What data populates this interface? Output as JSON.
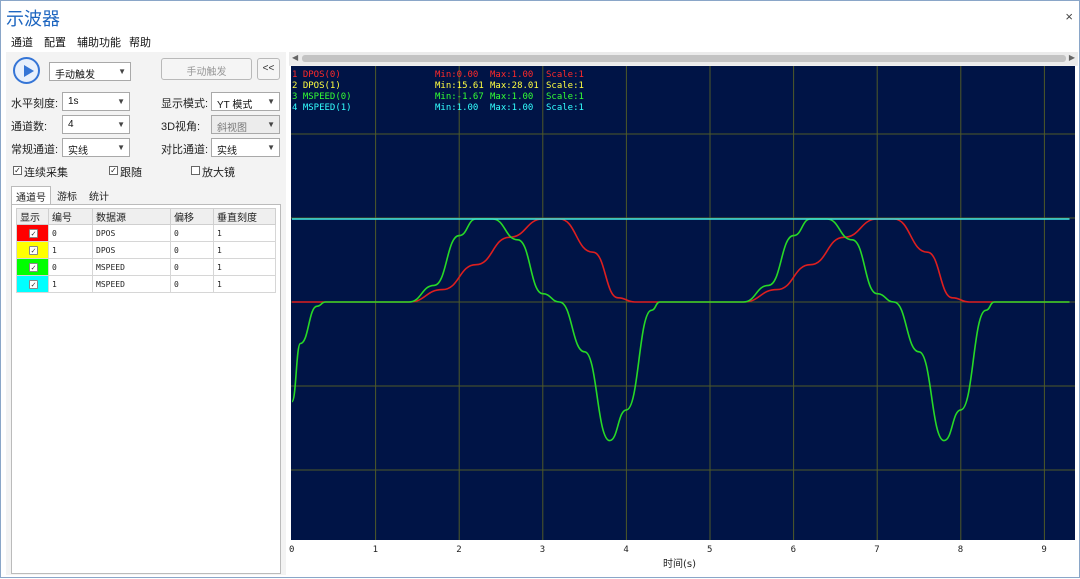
{
  "window": {
    "title": "示波器",
    "close_glyph": "×"
  },
  "menu": [
    "通道",
    "配置",
    "辅助功能",
    "帮助"
  ],
  "controls": {
    "trigger_mode": "手动触发",
    "manual_trigger_button": "手动触发",
    "collapse_button": "<<",
    "horizontal_scale_label": "水平刻度:",
    "horizontal_scale_value": "1s",
    "display_mode_label": "显示模式:",
    "display_mode_value": "YT 模式",
    "channel_count_label": "通道数:",
    "channel_count_value": "4",
    "view3d_label": "3D视角:",
    "view3d_value": "斜视图",
    "normal_channel_label": "常规通道:",
    "normal_channel_value": "实线",
    "compare_channel_label": "对比通道:",
    "compare_channel_value": "实线",
    "continuous_label": "连续采集",
    "continuous_checked": true,
    "follow_label": "跟随",
    "follow_checked": true,
    "magnifier_label": "放大镜",
    "magnifier_checked": false
  },
  "tabs": [
    "通道号",
    "游标",
    "统计"
  ],
  "channel_table": {
    "headers": [
      "显示",
      "编号",
      "数据源",
      "偏移",
      "垂直刻度"
    ],
    "rows": [
      {
        "color": "#ff0000",
        "shown": true,
        "id": "0",
        "source": "DPOS",
        "offset": "0",
        "scale": "1"
      },
      {
        "color": "#ffff00",
        "shown": true,
        "id": "1",
        "source": "DPOS",
        "offset": "0",
        "scale": "1"
      },
      {
        "color": "#00ff00",
        "shown": true,
        "id": "0",
        "source": "MSPEED",
        "offset": "0",
        "scale": "1"
      },
      {
        "color": "#00ffff",
        "shown": true,
        "id": "1",
        "source": "MSPEED",
        "offset": "0",
        "scale": "1"
      }
    ]
  },
  "scope": {
    "background": "#001446",
    "grid_color": "#4f5a28",
    "legend": [
      {
        "name": "1 DPOS(0)",
        "min": "Min:0.00",
        "max": "Max:1.00",
        "scale": "Scale:1",
        "color": "#ff2a2a"
      },
      {
        "name": "2 DPOS(1)",
        "min": "Min:15.61",
        "max": "Max:28.01",
        "scale": "Scale:1",
        "color": "#ffff40"
      },
      {
        "name": "3 MSPEED(0)",
        "min": "Min:-1.67",
        "max": "Max:1.00",
        "scale": "Scale:1",
        "color": "#33ff33"
      },
      {
        "name": "4 MSPEED(1)",
        "min": "Min:1.00",
        "max": "Max:1.00",
        "scale": "Scale:1",
        "color": "#33ffff"
      }
    ],
    "x_ticks": [
      "0",
      "1",
      "2",
      "3",
      "4",
      "5",
      "6",
      "7",
      "8",
      "9"
    ],
    "x_label": "时间(s)"
  },
  "chart_data": {
    "type": "line",
    "xlabel": "时间(s)",
    "x_ticks": [
      0,
      1,
      2,
      3,
      4,
      5,
      6,
      7,
      8,
      9
    ],
    "series": [
      {
        "name": "1 DPOS(0)",
        "color": "#dd1f1f",
        "x": [
          0,
          0.3,
          1.4,
          1.8,
          2.2,
          2.6,
          3.0,
          3.2,
          3.6,
          3.9,
          4.1,
          5.4,
          5.8,
          6.2,
          6.6,
          7.0,
          7.2,
          7.6,
          7.9,
          8.1,
          9.3
        ],
        "y": [
          0.0,
          0.0,
          0.0,
          0.15,
          0.45,
          0.78,
          1.0,
          1.0,
          0.6,
          0.05,
          0.0,
          0.0,
          0.15,
          0.45,
          0.78,
          1.0,
          1.0,
          0.6,
          0.05,
          0.0,
          0.0
        ]
      },
      {
        "name": "3 MSPEED(0)",
        "color": "#27d927",
        "x": [
          0,
          0.1,
          0.3,
          0.4,
          1.4,
          1.7,
          2.0,
          2.2,
          2.4,
          2.7,
          3.0,
          3.2,
          3.5,
          3.8,
          4.0,
          4.3,
          4.4,
          5.4,
          5.7,
          6.0,
          6.2,
          6.4,
          6.7,
          7.0,
          7.2,
          7.5,
          7.8,
          8.0,
          8.3,
          8.4,
          9.3
        ],
        "y": [
          -1.2,
          -0.5,
          -0.05,
          0.0,
          0.0,
          0.2,
          0.8,
          1.0,
          1.0,
          0.75,
          0.1,
          0.0,
          -0.6,
          -1.67,
          -1.3,
          -0.1,
          0.0,
          0.0,
          0.2,
          0.8,
          1.0,
          1.0,
          0.75,
          0.1,
          0.0,
          -0.6,
          -1.67,
          -1.3,
          -0.1,
          0.0,
          0.0
        ]
      },
      {
        "name": "4 MSPEED(1)",
        "color": "#3ee6e6",
        "x": [
          0,
          9.3
        ],
        "y": [
          1.0,
          1.0
        ]
      }
    ]
  }
}
